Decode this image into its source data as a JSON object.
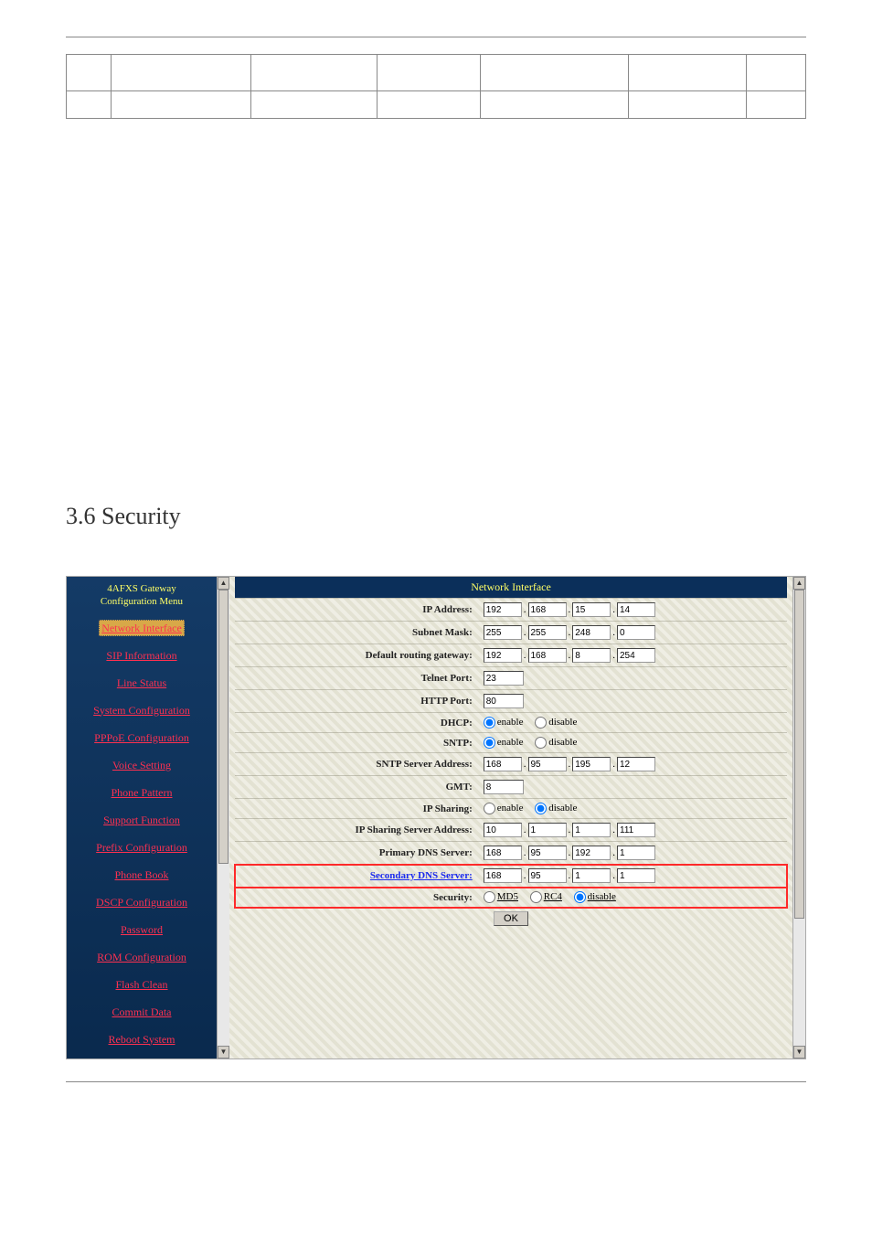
{
  "section": {
    "heading": "3.6  Security"
  },
  "sidebar": {
    "title_line1": "4AFXS Gateway",
    "title_line2": "Configuration Menu",
    "items": [
      {
        "label": "Network Interface",
        "active": true
      },
      {
        "label": "SIP Information"
      },
      {
        "label": "Line Status"
      },
      {
        "label": "System Configuration"
      },
      {
        "label": "PPPoE Configuration"
      },
      {
        "label": "Voice Setting"
      },
      {
        "label": "Phone Pattern"
      },
      {
        "label": "Support Function"
      },
      {
        "label": "Prefix Configuration"
      },
      {
        "label": "Phone Book"
      },
      {
        "label": "DSCP Configuration"
      },
      {
        "label": "Password"
      },
      {
        "label": "ROM Configuration"
      },
      {
        "label": "Flash Clean"
      },
      {
        "label": "Commit Data"
      },
      {
        "label": "Reboot System"
      }
    ]
  },
  "panel": {
    "title": "Network Interface",
    "rows": {
      "ip_address": {
        "label": "IP Address:",
        "v": [
          "192",
          "168",
          "15",
          "14"
        ]
      },
      "subnet_mask": {
        "label": "Subnet Mask:",
        "v": [
          "255",
          "255",
          "248",
          "0"
        ]
      },
      "default_gateway": {
        "label": "Default routing gateway:",
        "v": [
          "192",
          "168",
          "8",
          "254"
        ]
      },
      "telnet_port": {
        "label": "Telnet Port:",
        "v": "23"
      },
      "http_port": {
        "label": "HTTP Port:",
        "v": "80"
      },
      "dhcp": {
        "label": "DHCP:",
        "enable": "enable",
        "disable": "disable",
        "selected": "enable"
      },
      "sntp": {
        "label": "SNTP:",
        "enable": "enable",
        "disable": "disable",
        "selected": "enable"
      },
      "sntp_server": {
        "label": "SNTP Server Address:",
        "v": [
          "168",
          "95",
          "195",
          "12"
        ]
      },
      "gmt": {
        "label": "GMT:",
        "v": "8"
      },
      "ip_sharing": {
        "label": "IP Sharing:",
        "enable": "enable",
        "disable": "disable",
        "selected": "disable"
      },
      "ip_sharing_server": {
        "label": "IP Sharing Server Address:",
        "v": [
          "10",
          "1",
          "1",
          "111"
        ]
      },
      "primary_dns": {
        "label": "Primary DNS Server:",
        "v": [
          "168",
          "95",
          "192",
          "1"
        ]
      },
      "secondary_dns": {
        "label": "Secondary DNS Server:",
        "v": [
          "168",
          "95",
          "1",
          "1"
        ]
      },
      "security": {
        "label": "Security:",
        "opt1": "MD5",
        "opt2": "RC4",
        "opt3": "disable",
        "selected": "disable"
      }
    },
    "ok_label": "OK"
  }
}
